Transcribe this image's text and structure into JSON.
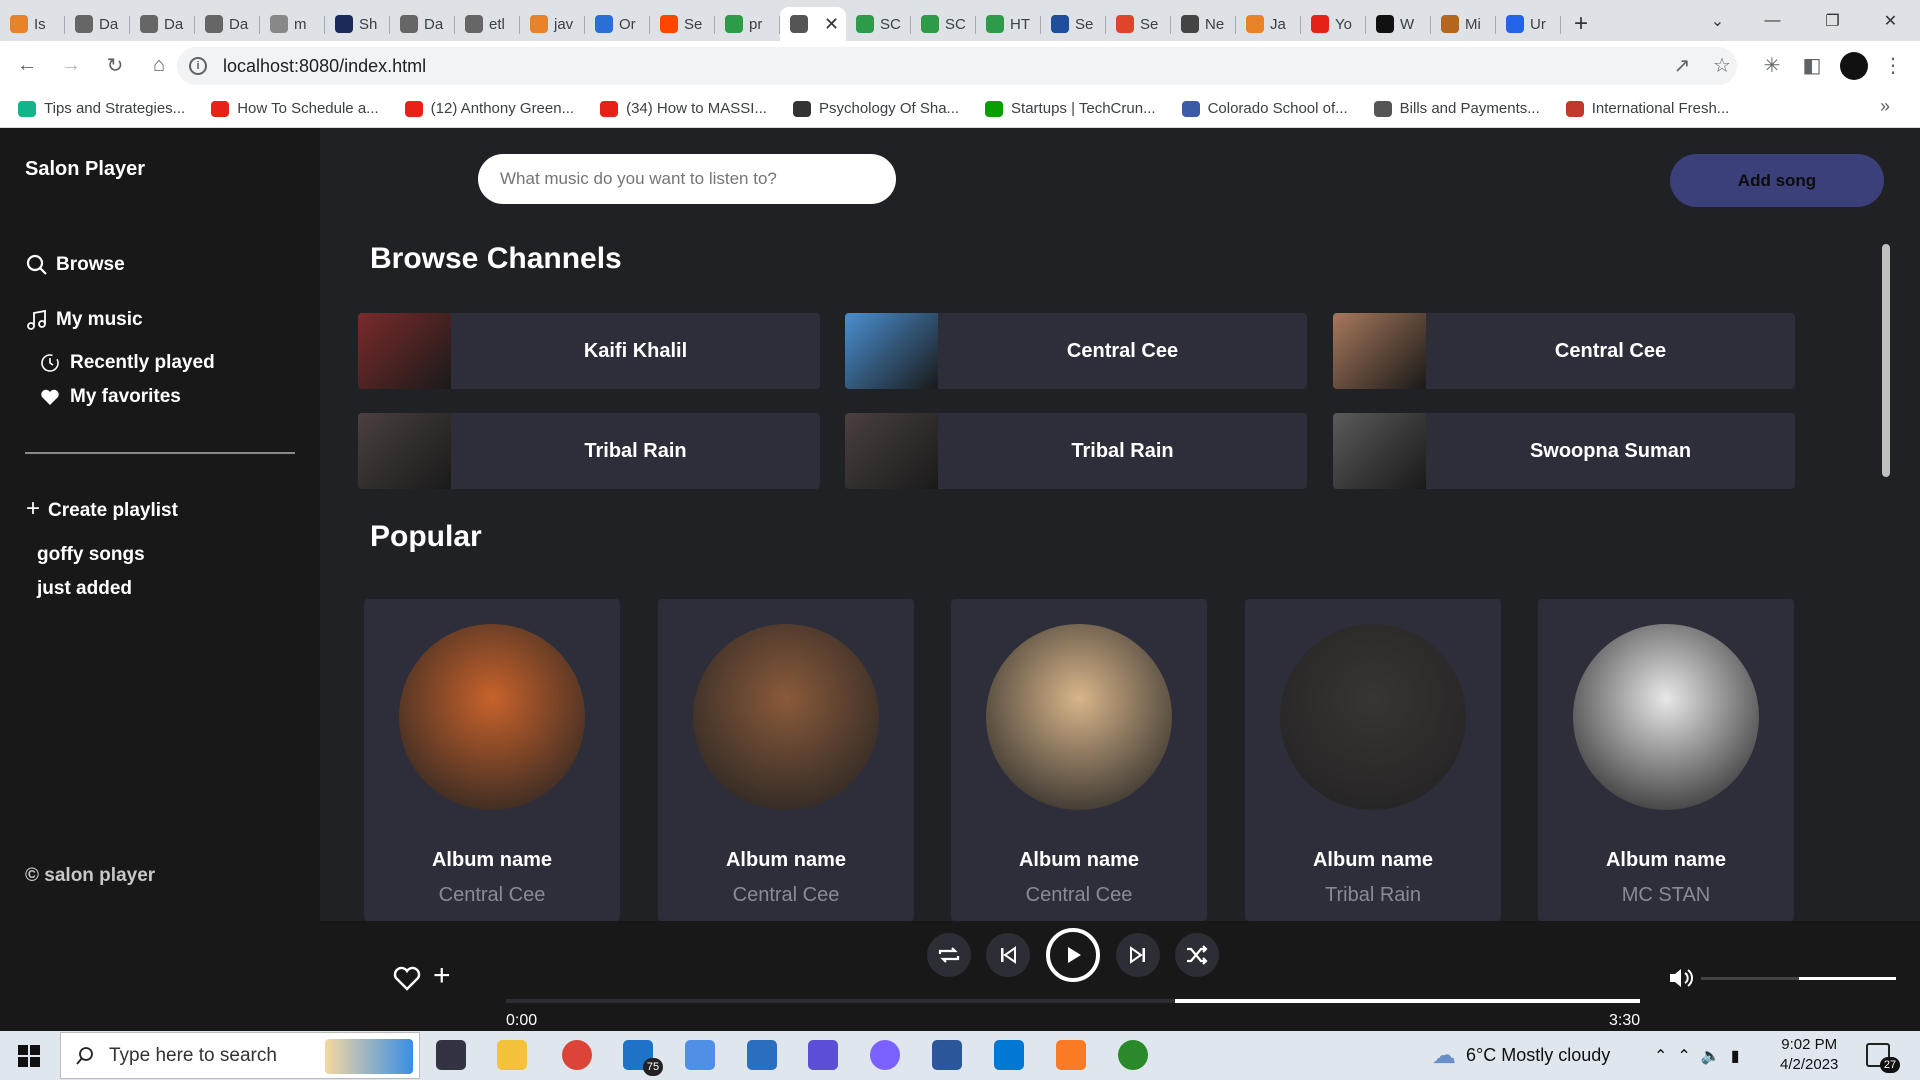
{
  "browser": {
    "tabs": [
      {
        "label": "Is",
        "color": "#e8832a"
      },
      {
        "label": "Da",
        "color": "#666666"
      },
      {
        "label": "Da",
        "color": "#666666"
      },
      {
        "label": "Da",
        "color": "#666666"
      },
      {
        "label": "m",
        "color": "#888888"
      },
      {
        "label": "Sh",
        "color": "#1a2a5a"
      },
      {
        "label": "Da",
        "color": "#666666"
      },
      {
        "label": "etl",
        "color": "#666666"
      },
      {
        "label": "jav",
        "color": "#e8832a"
      },
      {
        "label": "Or",
        "color": "#2a6fd6"
      },
      {
        "label": "Se",
        "color": "#ff4500"
      },
      {
        "label": "pr",
        "color": "#2e9b48"
      },
      {
        "label": "",
        "color": "#555555",
        "active": true
      },
      {
        "label": "SC",
        "color": "#2e9b48"
      },
      {
        "label": "SC",
        "color": "#2e9b48"
      },
      {
        "label": "HT",
        "color": "#2e9b48"
      },
      {
        "label": "Se",
        "color": "#1f4f9c"
      },
      {
        "label": "Se",
        "color": "#e0452b"
      },
      {
        "label": "Ne",
        "color": "#444444"
      },
      {
        "label": "Ja",
        "color": "#e8832a"
      },
      {
        "label": "Yo",
        "color": "#e62117"
      },
      {
        "label": "W",
        "color": "#111111"
      },
      {
        "label": "Mi",
        "color": "#b5651d"
      },
      {
        "label": "Ur",
        "color": "#2563eb"
      }
    ],
    "url": "localhost:8080/index.html",
    "bookmarks": [
      {
        "label": "Tips and Strategies...",
        "color": "#13b48a"
      },
      {
        "label": "How To Schedule a...",
        "color": "#e62117"
      },
      {
        "label": "(12) Anthony Green...",
        "color": "#e62117"
      },
      {
        "label": "(34) How to MASSI...",
        "color": "#e62117"
      },
      {
        "label": "Psychology Of Sha...",
        "color": "#333333"
      },
      {
        "label": "Startups | TechCrun...",
        "color": "#0a9e01"
      },
      {
        "label": "Colorado School of...",
        "color": "#3b5ba5"
      },
      {
        "label": "Bills and Payments...",
        "color": "#555555"
      },
      {
        "label": "International Fresh...",
        "color": "#c0392b"
      }
    ]
  },
  "app": {
    "brand": "Salon Player",
    "nav": {
      "browse": "Browse",
      "my_music": "My music",
      "recently_played": "Recently played",
      "my_favorites": "My favorites",
      "create_playlist": "Create playlist"
    },
    "playlists": [
      "goffy songs",
      "just added"
    ],
    "copyright": "© salon player",
    "search_placeholder": "What music do you want to listen to?",
    "add_song": "Add song",
    "browse_heading": "Browse Channels",
    "popular_heading": "Popular",
    "channels": [
      {
        "name": "Kaifi Khalil",
        "color": "#7a2a2a"
      },
      {
        "name": "Central Cee",
        "color": "#4a8fd0"
      },
      {
        "name": "Central Cee",
        "color": "#a7785a"
      },
      {
        "name": "Tribal Rain",
        "color": "#4a4040"
      },
      {
        "name": "Tribal Rain",
        "color": "#4a4040"
      },
      {
        "name": "Swoopna Suman",
        "color": "#5a5a5a"
      }
    ],
    "albums": [
      {
        "name": "Album name",
        "artist": "Central Cee",
        "color": "#c8622b"
      },
      {
        "name": "Album name",
        "artist": "Central Cee",
        "color": "#8a5a3a"
      },
      {
        "name": "Album name",
        "artist": "Central Cee",
        "color": "#d8b58a"
      },
      {
        "name": "Album name",
        "artist": "Tribal Rain",
        "color": "#3a3434"
      },
      {
        "name": "Album name",
        "artist": "MC STAN",
        "color": "#e8e8e8"
      }
    ],
    "player": {
      "time_current": "0:00",
      "time_total": "3:30",
      "progress_fraction": 0.0,
      "volume_fraction": 0.5
    }
  },
  "taskbar": {
    "search_placeholder": "Type here to search",
    "weather": "6°C  Mostly cloudy",
    "time": "9:02 PM",
    "date": "4/2/2023",
    "mail_badge": "75",
    "notifications": "27"
  }
}
